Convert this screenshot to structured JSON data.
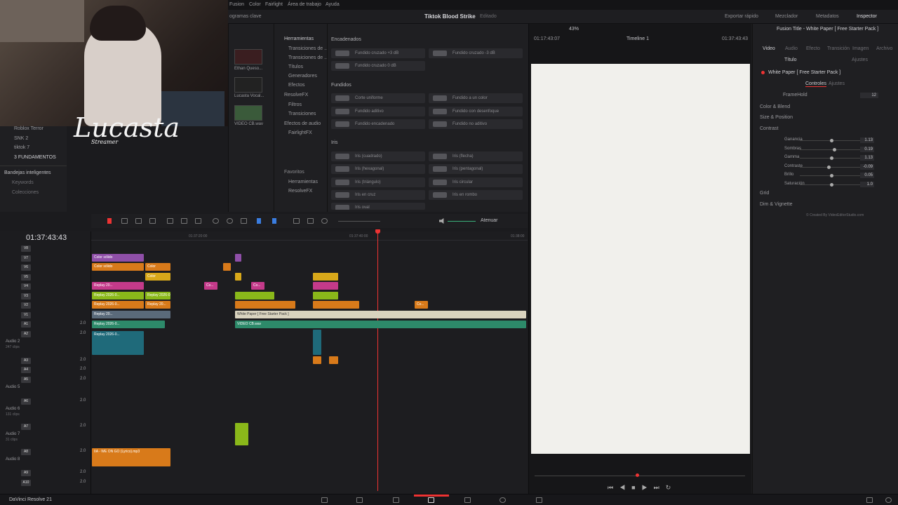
{
  "menu": {
    "items": [
      "Fusion",
      "Color",
      "Fairlight",
      "Área de trabajo",
      "Ayuda"
    ]
  },
  "topbar": {
    "project": "Tiktok Blood Strike",
    "state": "Editado",
    "export": "Exportar rápido",
    "mixer": "Mezclador",
    "metadata": "Metadatos",
    "inspector": "Inspector",
    "keywords_tab": "ogramas clave"
  },
  "webcam": {
    "logo": "Lucasta",
    "logo_sub": "Streamer"
  },
  "bins": {
    "items": [
      "Roblox Terror",
      "SNK 2",
      "tiktok 7",
      "3 FUNDAMENTOS"
    ],
    "smart": "Bandejas inteligentes",
    "keywords": "Keywords",
    "collections": "Colecciones"
  },
  "media": {
    "items": [
      "Ethan Queso...",
      "Lucasta Vocal...",
      "VIDEO CB.wav"
    ]
  },
  "effects_tree": {
    "root": "Herramientas",
    "items": [
      "Transiciones de ...",
      "Transiciones de ...",
      "Títulos",
      "Generadores",
      "Efectos",
      "ResolveFX",
      "Filtros",
      "Transiciones",
      "Efectos de audio",
      "FairlightFX"
    ],
    "favorites": "Favoritos",
    "fav_items": [
      "Herramientas",
      "ResolveFX"
    ]
  },
  "effects": {
    "enc_title": "Encadenados",
    "enc": [
      "Fundido cruzado +3 dB",
      "Fundido cruzado -3 dB",
      "Fundido cruzado 0 dB"
    ],
    "fund_title": "Fundidos",
    "fund": [
      "Corte uniforme",
      "Fundido a un color",
      "Fundido aditivo",
      "Fundido con desenfoque",
      "Fundido encadenado",
      "Fundido no aditivo"
    ],
    "iris_title": "Iris",
    "iris": [
      "Iris (cuadrado)",
      "Iris (flecha)",
      "Iris (hexagonal)",
      "Iris (pentagonal)",
      "Iris (triángulo)",
      "Iris circular",
      "Iris en cruz",
      "Iris en rombo",
      "Iris oval"
    ]
  },
  "viewer": {
    "zoom": "43%",
    "timecode": "01:17:43:07",
    "timeline": "Timeline 1",
    "tc_right": "01:37:43:43"
  },
  "inspector": {
    "title": "Fusion Title - White Paper [ Free Starter Pack ]",
    "tabs": [
      "Video",
      "Audio",
      "Efecto",
      "Transición",
      "Imagen",
      "Archivo"
    ],
    "subtabs": [
      "Título",
      "Ajustes"
    ],
    "node": "White Paper [ Free Starter Pack ]",
    "ctrl_tabs": [
      "Controles",
      "Ajustes"
    ],
    "framehold_label": "FrameHold",
    "framehold": "12",
    "sections": [
      "Color & Blend",
      "Size & Position",
      "Contrast",
      "Grid",
      "Dim & Vignette"
    ],
    "params": [
      {
        "label": "Ganancia",
        "value": "1.13",
        "pos": 0.5
      },
      {
        "label": "Sombras",
        "value": "0.19",
        "pos": 0.55
      },
      {
        "label": "Gamma",
        "value": "1.13",
        "pos": 0.5
      },
      {
        "label": "Contraste",
        "value": "-0.09",
        "pos": 0.45
      },
      {
        "label": "Brillo",
        "value": "0.05",
        "pos": 0.5
      },
      {
        "label": "Saturación",
        "value": "1.0",
        "pos": 0.5
      }
    ],
    "credit": "© Created By VideoEditorStudio.com"
  },
  "timeline": {
    "timecode": "01:37:43:43",
    "ruler": [
      "01:37:20:00",
      "01:37:40:00",
      "01:38:00"
    ],
    "atenuar": "Atenuar",
    "video_tracks": [
      "V8",
      "V7",
      "V6",
      "V5",
      "V4",
      "V3",
      "V2",
      "V1"
    ],
    "audio_tracks": [
      {
        "id": "A1",
        "name": "",
        "vol": "2.0"
      },
      {
        "id": "A2",
        "name": "Audio 2",
        "clips": "247 clips",
        "vol": "2.0"
      },
      {
        "id": "A3",
        "name": "",
        "vol": "2.0"
      },
      {
        "id": "A4",
        "name": "",
        "vol": "2.0"
      },
      {
        "id": "A5",
        "name": "Audio 5",
        "vol": "2.0"
      },
      {
        "id": "A6",
        "name": "Audio 6",
        "clips": "131 clips",
        "vol": "2.0"
      },
      {
        "id": "A7",
        "name": "Audio 7",
        "clips": "31 clips",
        "vol": "2.0"
      },
      {
        "id": "A8",
        "name": "Audio 8",
        "vol": "2.0"
      },
      {
        "id": "A9",
        "name": "",
        "vol": "2.0"
      },
      {
        "id": "A10",
        "name": "",
        "vol": "2.0"
      }
    ],
    "clips": {
      "color_solido": "Color sólido",
      "color": "Color",
      "replay": "Replay 20...",
      "replay2": "Replay 2026-0...",
      "white_paper": "White Paper [ Free Starter Pack ]",
      "video_cb": "VIDEO CB.wav",
      "music": "IIA - WE ON GO (Lyrics).mp3",
      "co": "Co..."
    }
  },
  "footer": {
    "app": "DaVinci Resolve 21"
  }
}
